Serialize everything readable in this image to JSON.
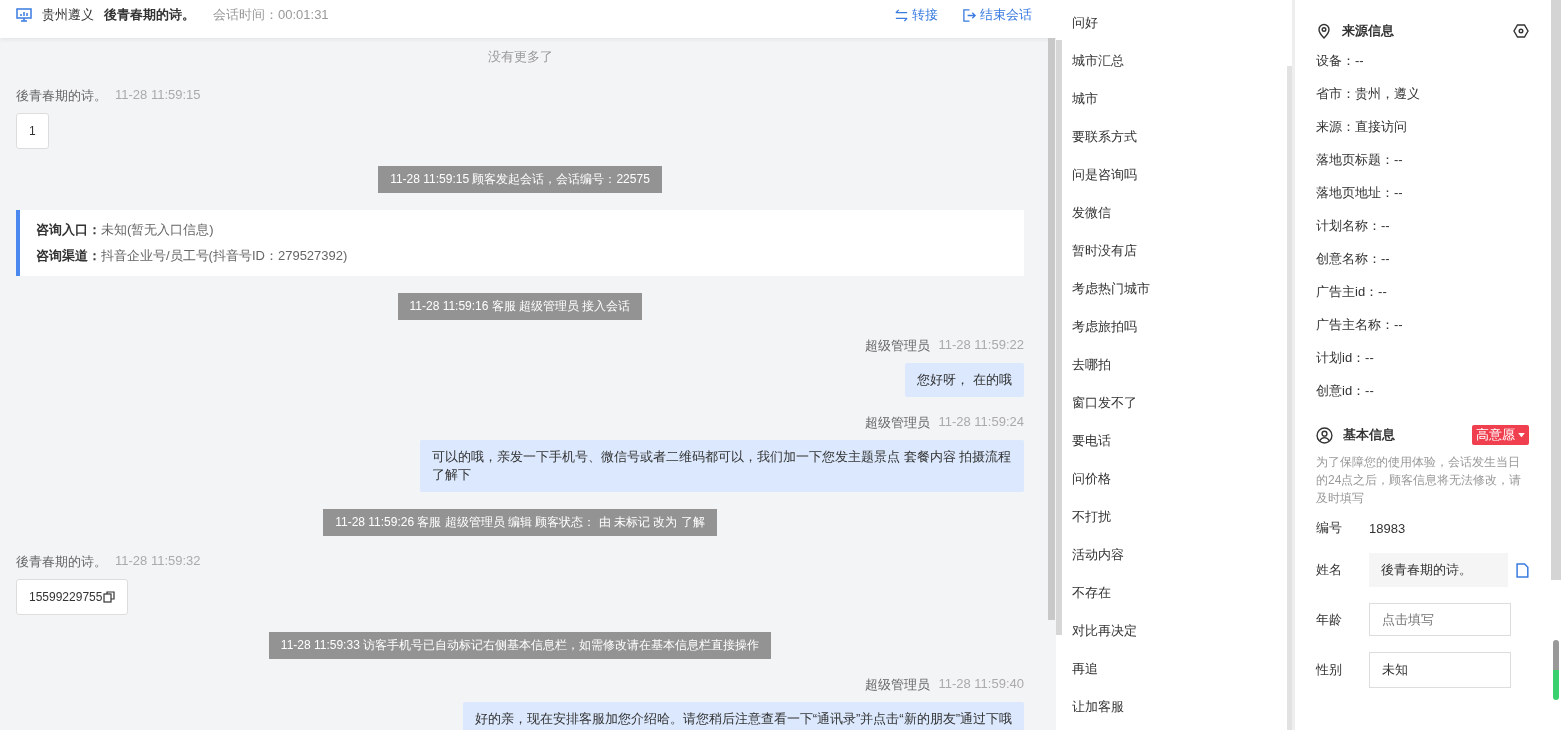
{
  "header": {
    "location": "贵州遵义",
    "name": "後青春期的诗。",
    "duration": "会话时间：00:01:31",
    "actions": [
      {
        "kind": "transfer",
        "label": "转接"
      },
      {
        "kind": "exit",
        "label": "结束会话"
      }
    ]
  },
  "messages": [
    {
      "kind": "notice",
      "text": "没有更多了"
    },
    {
      "kind": "visitor",
      "name": "後青春期的诗。",
      "time": "11-28 11:59:15",
      "text": "1",
      "copyable": false
    },
    {
      "kind": "system",
      "text": "11-28 11:59:15 顾客发起会话，会话编号：22575"
    },
    {
      "kind": "info",
      "rows": [
        {
          "label": "咨询入口：",
          "value": "未知(暂无入口信息)"
        },
        {
          "label": "咨询渠道：",
          "value": "抖音企业号/员工号(抖音号ID：279527392)"
        }
      ]
    },
    {
      "kind": "system",
      "text": "11-28 11:59:16 客服 超级管理员 接入会话"
    },
    {
      "kind": "agent",
      "name": "超级管理员",
      "time": "11-28 11:59:22",
      "text": "您好呀， 在的哦"
    },
    {
      "kind": "agent",
      "name": "超级管理员",
      "time": "11-28 11:59:24",
      "text": "可以的哦，亲发一下手机号、微信号或者二维码都可以，我们加一下您发主题景点 套餐内容 拍摄流程了解下"
    },
    {
      "kind": "system",
      "text": "11-28 11:59:26 客服 超级管理员 编辑 顾客状态： 由 未标记 改为 了解"
    },
    {
      "kind": "visitor",
      "name": "後青春期的诗。",
      "time": "11-28 11:59:32",
      "text": "15599229755",
      "copyable": true
    },
    {
      "kind": "system",
      "text": "11-28 11:59:33 访客手机号已自动标记右侧基本信息栏，如需修改请在基本信息栏直接操作"
    },
    {
      "kind": "agent",
      "name": "超级管理员",
      "time": "11-28 11:59:40",
      "text": "好的亲，现在安排客服加您介绍哈。请您稍后注意查看一下“通讯录”并点击“新的朋友”通过下哦"
    }
  ],
  "quick_replies": [
    "问好",
    "城市汇总",
    "城市",
    "要联系方式",
    "问是咨询吗",
    "发微信",
    "暂时没有店",
    "考虑热门城市",
    "考虑旅拍吗",
    "去哪拍",
    "窗口发不了",
    "要电话",
    "问价格",
    "不打扰",
    "活动内容",
    "不存在",
    "对比再决定",
    "再追",
    "让加客服"
  ],
  "source": {
    "title": "来源信息",
    "rows": [
      "设备：--",
      "省市：贵州，遵义",
      "来源：直接访问",
      "落地页标题：--",
      "落地页地址：--",
      "计划名称：--",
      "创意名称：--",
      "广告主id：--",
      "广告主名称：--",
      "计划id：--",
      "创意id：--"
    ]
  },
  "basic": {
    "title": "基本信息",
    "tag": "高意愿",
    "note": "为了保障您的使用体验，会话发生当日的24点之后，顾客信息将无法修改，请及时填写",
    "fields": [
      {
        "kind": "text",
        "label": "编号",
        "value": "18983"
      },
      {
        "kind": "readonly",
        "label": "姓名",
        "value": "後青春期的诗。"
      },
      {
        "kind": "input",
        "label": "年龄",
        "placeholder": "点击填写"
      },
      {
        "kind": "select",
        "label": "性别",
        "value": "未知"
      }
    ]
  }
}
